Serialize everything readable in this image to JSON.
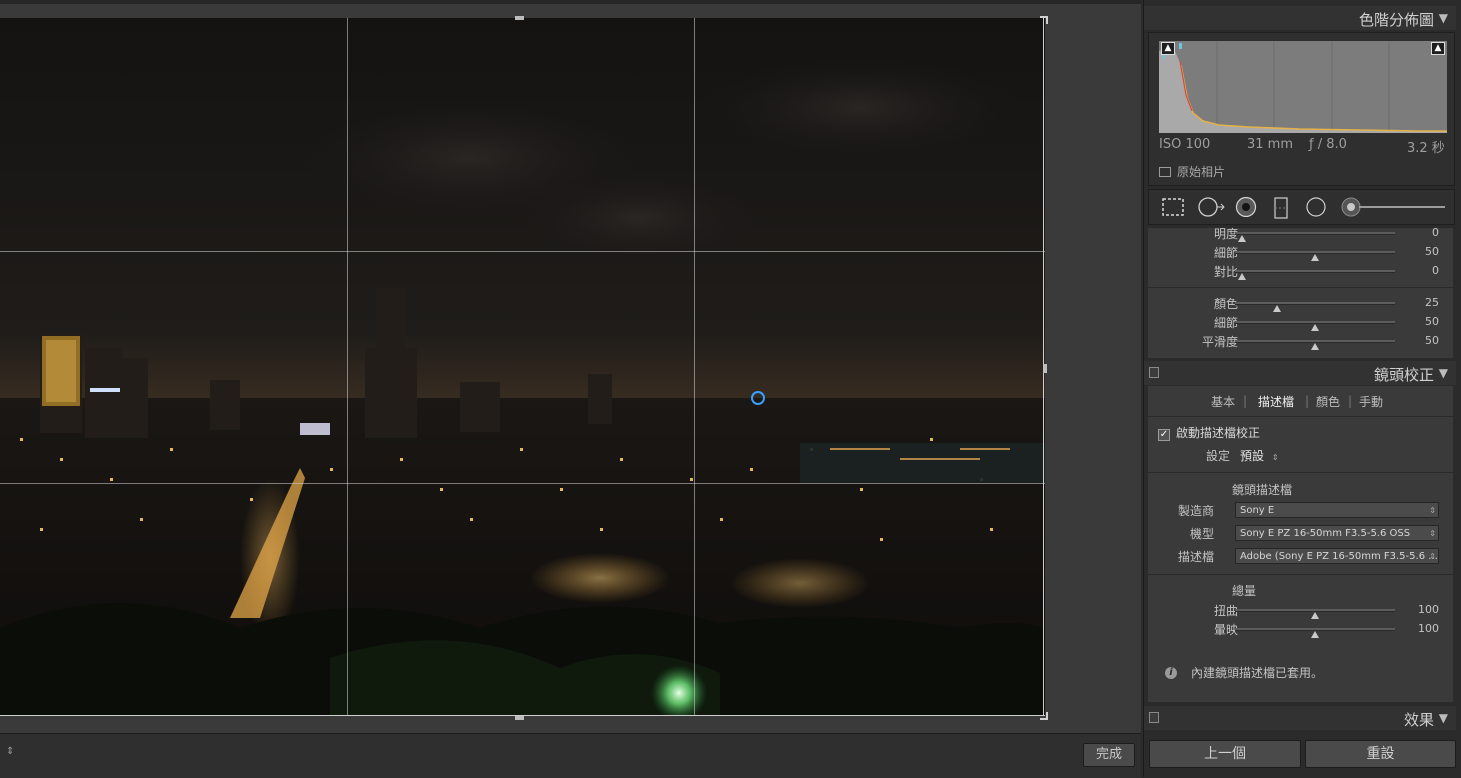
{
  "toolbar": {
    "done_label": "完成",
    "arrow_glyph": "⇕"
  },
  "histogram": {
    "title": "色階分佈圖",
    "iso": "ISO 100",
    "focal": "31 mm",
    "aperture": "ƒ / 8.0",
    "shutter": "3.2 秒",
    "original_label": "原始相片"
  },
  "sliders_top": [
    {
      "label": "明度",
      "value": "0",
      "level": 0.02
    },
    {
      "label": "細節",
      "value": "50",
      "level": 0.5
    },
    {
      "label": "對比",
      "value": "0",
      "level": 0.02
    }
  ],
  "sliders_color": [
    {
      "label": "顏色",
      "value": "25",
      "level": 0.25
    },
    {
      "label": "細節",
      "value": "50",
      "level": 0.5
    },
    {
      "label": "平滑度",
      "value": "50",
      "level": 0.5
    }
  ],
  "lens": {
    "title": "鏡頭校正",
    "tabs": [
      "基本",
      "描述檔",
      "顏色",
      "手動"
    ],
    "active_tab": "描述檔",
    "enable_label": "啟動描述檔校正",
    "setup_label": "設定",
    "setup_value": "預設",
    "section_label": "鏡頭描述檔",
    "make_label": "製造商",
    "make_value": "Sony E",
    "model_label": "機型",
    "model_value": "Sony E PZ 16-50mm F3.5-5.6 OSS",
    "profile_label": "描述檔",
    "profile_value": "Adobe (Sony E PZ 16-50mm F3.5-5.6 ...",
    "amount_label": "總量",
    "distortion_label": "扭曲",
    "distortion_value": "100",
    "vignetting_label": "暈映",
    "vignetting_value": "100",
    "info_text": "內建鏡頭描述檔已套用。"
  },
  "effects": {
    "title": "效果"
  },
  "buttons": {
    "prev": "上一個",
    "reset": "重設"
  },
  "colors": {
    "accent_orange": "#e0a040",
    "panel_bg": "#3a3a3a"
  }
}
